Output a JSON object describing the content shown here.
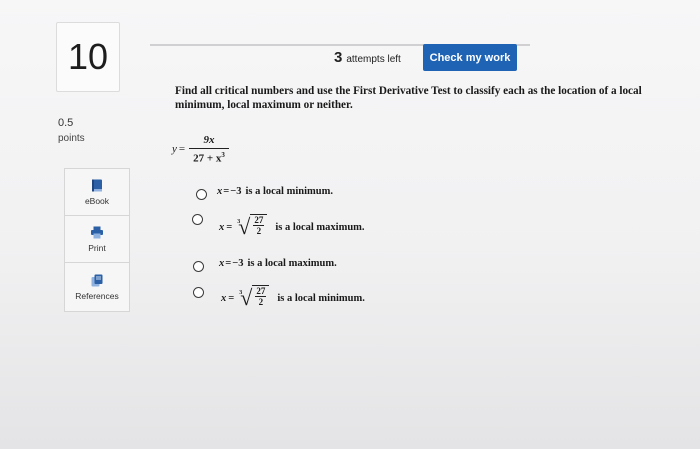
{
  "question": {
    "number": "10",
    "points_value": "0.5",
    "points_label": "points",
    "prompt": "Find all critical numbers and use the First Derivative Test to classify each as the location of a local minimum, local maximum or neither."
  },
  "resources": [
    {
      "label": "eBook",
      "icon": "book-icon"
    },
    {
      "label": "Print",
      "icon": "printer-icon"
    },
    {
      "label": "References",
      "icon": "references-icon"
    }
  ],
  "header": {
    "attempts_count": "3",
    "attempts_label": "attempts left",
    "check_button": "Check my work"
  },
  "function": {
    "lhs": "y",
    "eq": "=",
    "numerator": "9x",
    "denominator": "27 + x",
    "exponent": "3"
  },
  "options": [
    {
      "lhs": "x",
      "eq": "=",
      "value": "−3",
      "text": "is a local minimum."
    },
    {
      "lhs": "x",
      "eq": "=",
      "root_index": "3",
      "root_num": "27",
      "root_den": "2",
      "text": "is a local maximum."
    },
    {
      "lhs": "x",
      "eq": "=",
      "value": "−3",
      "text": "is a local maximum."
    },
    {
      "lhs": "x",
      "eq": "=",
      "root_index": "3",
      "root_num": "27",
      "root_den": "2",
      "text": "is a local minimum."
    }
  ],
  "colors": {
    "accent": "#1f63b5",
    "background": "#f4f4f5"
  }
}
